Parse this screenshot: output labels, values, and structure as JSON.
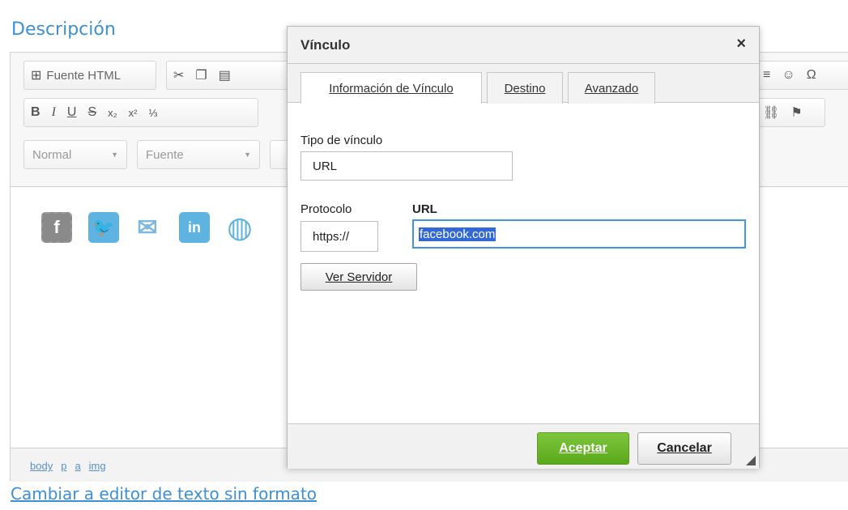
{
  "page": {
    "section_title": "Descripción",
    "plain_editor_link": "Cambiar a editor de texto sin formato"
  },
  "toolbar": {
    "source_label": "Fuente HTML",
    "format_value": "Normal",
    "font_value": "Fuente"
  },
  "statusbar": {
    "path": [
      "body",
      "p",
      "a",
      "img"
    ]
  },
  "social_icons": [
    "facebook-icon",
    "twitter-icon",
    "mail-icon",
    "linkedin-icon",
    "globe-icon"
  ],
  "dialog": {
    "title": "Vínculo",
    "close_glyph": "×",
    "tabs": [
      {
        "label": "Información de Vínculo",
        "active": true
      },
      {
        "label": "Destino",
        "active": false
      },
      {
        "label": "Avanzado",
        "active": false
      }
    ],
    "link_type_label": "Tipo de vínculo",
    "link_type_value": "URL",
    "protocol_label": "Protocolo",
    "protocol_value": "https://",
    "url_label": "URL",
    "url_value": "facebook.com",
    "browse_button": "Ver Servidor",
    "ok_button": "Aceptar",
    "cancel_button": "Cancelar"
  },
  "colors": {
    "accent_blue": "#3d8fd6",
    "ok_green": "#6bb82c",
    "selection": "#3369d6"
  }
}
